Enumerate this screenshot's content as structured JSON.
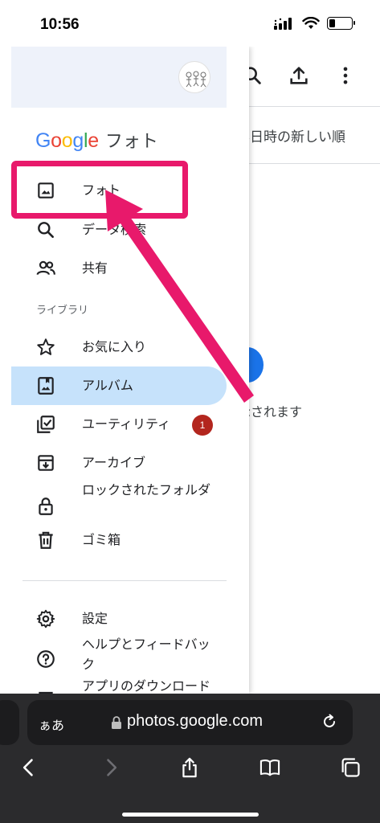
{
  "status_bar": {
    "time": "10:56"
  },
  "background_page": {
    "sort_label": "影日時の新しい順",
    "empty_message": "示されます",
    "toolbar_icons": [
      "search-icon",
      "upload-icon",
      "more-vert-icon"
    ]
  },
  "drawer": {
    "brand": {
      "google": "Google",
      "product": "フォト"
    },
    "nav": {
      "photos": "フォト",
      "search": "データ検索",
      "sharing": "共有"
    },
    "library_header": "ライブラリ",
    "library": {
      "favorites": "お気に入り",
      "albums": "アルバム",
      "utilities": "ユーティリティ",
      "utilities_badge": "1",
      "archive": "アーカイブ",
      "locked_folder": "ロックされたフォルダ",
      "trash": "ゴミ箱"
    },
    "footer": {
      "settings": "設定",
      "help_feedback": "ヘルプとフィードバック",
      "app_download": "アプリのダウンロード"
    },
    "active_item": "albums"
  },
  "browser": {
    "aa_label": "ぁあ",
    "url": "photos.google.com",
    "toolbar_icons": [
      "back-icon",
      "forward-icon",
      "share-icon",
      "bookmarks-icon",
      "tabs-icon"
    ]
  },
  "colors": {
    "annotation": "#e8196b",
    "active_item_bg": "#c6e2fb",
    "badge": "#b3261e",
    "google_blue": "#4285f4",
    "google_red": "#ea4335",
    "google_yellow": "#fbbc05",
    "google_green": "#34a853"
  }
}
